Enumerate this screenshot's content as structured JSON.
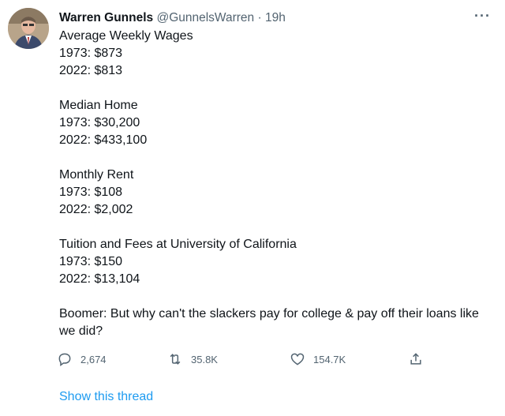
{
  "tweet": {
    "author_name": "Warren Gunnels",
    "handle": "@GunnelsWarren",
    "separator": "·",
    "time": "19h",
    "more_menu": "···",
    "body": {
      "wages_title": "Average Weekly Wages",
      "wages_1973": "1973: $873",
      "wages_2022": "2022: $813",
      "home_title": "Median Home",
      "home_1973": "1973: $30,200",
      "home_2022": "2022: $433,100",
      "rent_title": "Monthly Rent",
      "rent_1973": "1973: $108",
      "rent_2022": "2022: $2,002",
      "tuition_title": "Tuition and Fees at University of California",
      "tuition_1973": "1973: $150",
      "tuition_2022": "2022: $13,104",
      "closing": "Boomer: But why can't the slackers pay for college & pay off their loans like we did?"
    },
    "actions": {
      "replies": "2,674",
      "retweets": "35.8K",
      "likes": "154.7K"
    },
    "show_thread": "Show this thread",
    "icons": {
      "reply": "reply-icon",
      "retweet": "retweet-icon",
      "like": "heart-icon",
      "share": "share-icon"
    },
    "colors": {
      "text": "#0f1419",
      "secondary": "#536471",
      "link": "#1d9bf0"
    }
  }
}
